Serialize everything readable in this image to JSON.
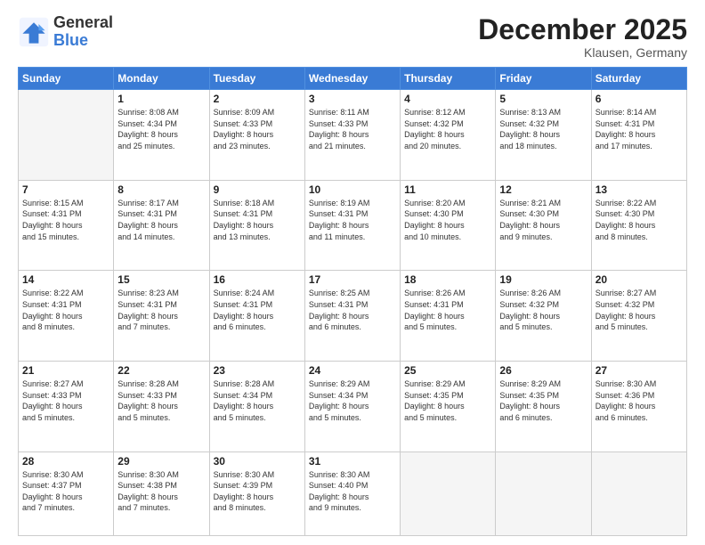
{
  "header": {
    "logo_general": "General",
    "logo_blue": "Blue",
    "title": "December 2025",
    "location": "Klausen, Germany"
  },
  "weekdays": [
    "Sunday",
    "Monday",
    "Tuesday",
    "Wednesday",
    "Thursday",
    "Friday",
    "Saturday"
  ],
  "weeks": [
    [
      {
        "date": "",
        "info": ""
      },
      {
        "date": "1",
        "info": "Sunrise: 8:08 AM\nSunset: 4:34 PM\nDaylight: 8 hours\nand 25 minutes."
      },
      {
        "date": "2",
        "info": "Sunrise: 8:09 AM\nSunset: 4:33 PM\nDaylight: 8 hours\nand 23 minutes."
      },
      {
        "date": "3",
        "info": "Sunrise: 8:11 AM\nSunset: 4:33 PM\nDaylight: 8 hours\nand 21 minutes."
      },
      {
        "date": "4",
        "info": "Sunrise: 8:12 AM\nSunset: 4:32 PM\nDaylight: 8 hours\nand 20 minutes."
      },
      {
        "date": "5",
        "info": "Sunrise: 8:13 AM\nSunset: 4:32 PM\nDaylight: 8 hours\nand 18 minutes."
      },
      {
        "date": "6",
        "info": "Sunrise: 8:14 AM\nSunset: 4:31 PM\nDaylight: 8 hours\nand 17 minutes."
      }
    ],
    [
      {
        "date": "7",
        "info": "Sunrise: 8:15 AM\nSunset: 4:31 PM\nDaylight: 8 hours\nand 15 minutes."
      },
      {
        "date": "8",
        "info": "Sunrise: 8:17 AM\nSunset: 4:31 PM\nDaylight: 8 hours\nand 14 minutes."
      },
      {
        "date": "9",
        "info": "Sunrise: 8:18 AM\nSunset: 4:31 PM\nDaylight: 8 hours\nand 13 minutes."
      },
      {
        "date": "10",
        "info": "Sunrise: 8:19 AM\nSunset: 4:31 PM\nDaylight: 8 hours\nand 11 minutes."
      },
      {
        "date": "11",
        "info": "Sunrise: 8:20 AM\nSunset: 4:30 PM\nDaylight: 8 hours\nand 10 minutes."
      },
      {
        "date": "12",
        "info": "Sunrise: 8:21 AM\nSunset: 4:30 PM\nDaylight: 8 hours\nand 9 minutes."
      },
      {
        "date": "13",
        "info": "Sunrise: 8:22 AM\nSunset: 4:30 PM\nDaylight: 8 hours\nand 8 minutes."
      }
    ],
    [
      {
        "date": "14",
        "info": "Sunrise: 8:22 AM\nSunset: 4:31 PM\nDaylight: 8 hours\nand 8 minutes."
      },
      {
        "date": "15",
        "info": "Sunrise: 8:23 AM\nSunset: 4:31 PM\nDaylight: 8 hours\nand 7 minutes."
      },
      {
        "date": "16",
        "info": "Sunrise: 8:24 AM\nSunset: 4:31 PM\nDaylight: 8 hours\nand 6 minutes."
      },
      {
        "date": "17",
        "info": "Sunrise: 8:25 AM\nSunset: 4:31 PM\nDaylight: 8 hours\nand 6 minutes."
      },
      {
        "date": "18",
        "info": "Sunrise: 8:26 AM\nSunset: 4:31 PM\nDaylight: 8 hours\nand 5 minutes."
      },
      {
        "date": "19",
        "info": "Sunrise: 8:26 AM\nSunset: 4:32 PM\nDaylight: 8 hours\nand 5 minutes."
      },
      {
        "date": "20",
        "info": "Sunrise: 8:27 AM\nSunset: 4:32 PM\nDaylight: 8 hours\nand 5 minutes."
      }
    ],
    [
      {
        "date": "21",
        "info": "Sunrise: 8:27 AM\nSunset: 4:33 PM\nDaylight: 8 hours\nand 5 minutes."
      },
      {
        "date": "22",
        "info": "Sunrise: 8:28 AM\nSunset: 4:33 PM\nDaylight: 8 hours\nand 5 minutes."
      },
      {
        "date": "23",
        "info": "Sunrise: 8:28 AM\nSunset: 4:34 PM\nDaylight: 8 hours\nand 5 minutes."
      },
      {
        "date": "24",
        "info": "Sunrise: 8:29 AM\nSunset: 4:34 PM\nDaylight: 8 hours\nand 5 minutes."
      },
      {
        "date": "25",
        "info": "Sunrise: 8:29 AM\nSunset: 4:35 PM\nDaylight: 8 hours\nand 5 minutes."
      },
      {
        "date": "26",
        "info": "Sunrise: 8:29 AM\nSunset: 4:35 PM\nDaylight: 8 hours\nand 6 minutes."
      },
      {
        "date": "27",
        "info": "Sunrise: 8:30 AM\nSunset: 4:36 PM\nDaylight: 8 hours\nand 6 minutes."
      }
    ],
    [
      {
        "date": "28",
        "info": "Sunrise: 8:30 AM\nSunset: 4:37 PM\nDaylight: 8 hours\nand 7 minutes."
      },
      {
        "date": "29",
        "info": "Sunrise: 8:30 AM\nSunset: 4:38 PM\nDaylight: 8 hours\nand 7 minutes."
      },
      {
        "date": "30",
        "info": "Sunrise: 8:30 AM\nSunset: 4:39 PM\nDaylight: 8 hours\nand 8 minutes."
      },
      {
        "date": "31",
        "info": "Sunrise: 8:30 AM\nSunset: 4:40 PM\nDaylight: 8 hours\nand 9 minutes."
      },
      {
        "date": "",
        "info": ""
      },
      {
        "date": "",
        "info": ""
      },
      {
        "date": "",
        "info": ""
      }
    ]
  ]
}
